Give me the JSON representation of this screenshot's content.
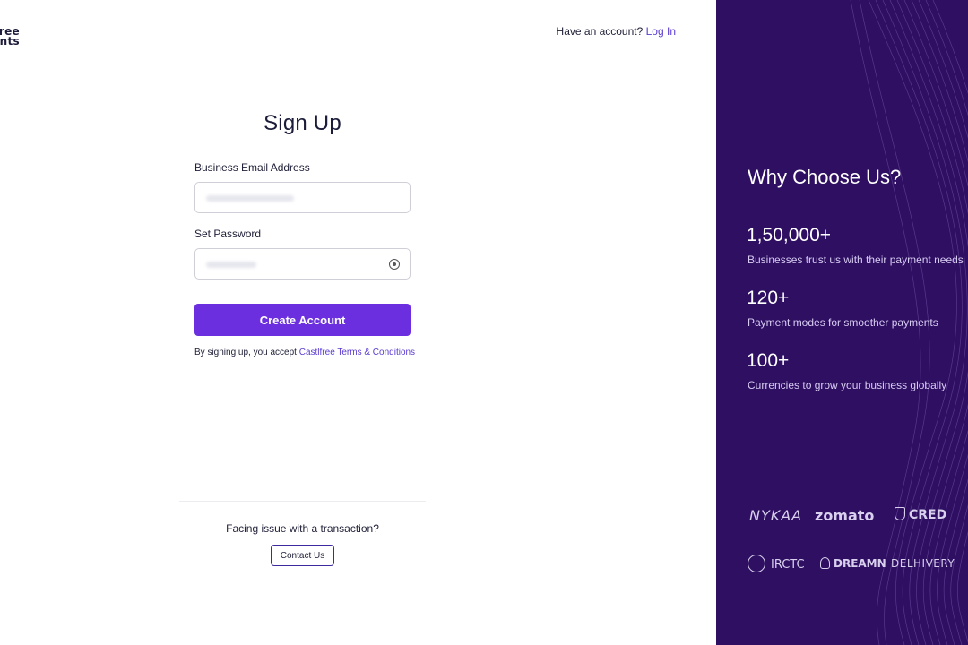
{
  "header": {
    "logo_lines": [
      "free",
      "ents"
    ],
    "login_prompt": "Have an account?",
    "login_link": "Log In"
  },
  "form": {
    "title": "Sign Up",
    "email_label": "Business Email Address",
    "password_label": "Set Password",
    "submit_label": "Create Account",
    "terms_prefix": "By signing up, you accept",
    "terms_link": "Castlfree Terms & Conditions"
  },
  "support": {
    "text": "Facing issue with a transaction?",
    "button": "Contact Us"
  },
  "promo": {
    "heading": "Why Choose Us?",
    "stats": [
      {
        "value": "1,50,000+",
        "desc": "Businesses trust us with their payment needs"
      },
      {
        "value": "120+",
        "desc": "Payment modes for smoother payments"
      },
      {
        "value": "100+",
        "desc": "Currencies to grow your business globally"
      }
    ],
    "brands": [
      "NYKAA",
      "zomato",
      "CRED",
      "IRCTC",
      "DREAMN",
      "DELHIVERY"
    ]
  },
  "colors": {
    "accent": "#6b2fe0",
    "panel": "#2e0f62",
    "link": "#5b3bd1"
  }
}
